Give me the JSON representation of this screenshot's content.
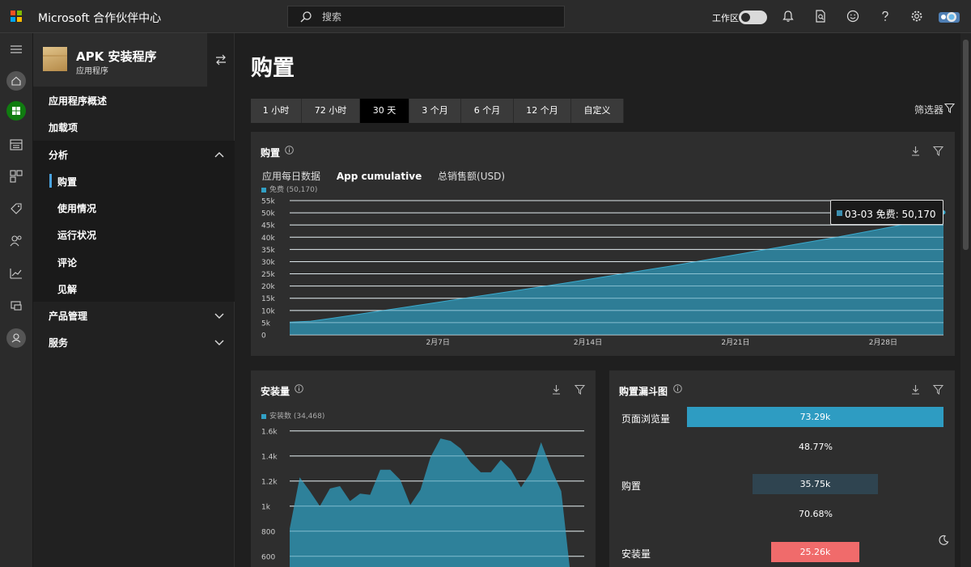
{
  "topbar": {
    "app_name": "Microsoft 合作伙伴中心",
    "search_placeholder": "搜索",
    "workspace_label": "工作区",
    "logo_colors": [
      "#f25022",
      "#7fba00",
      "#00a4ef",
      "#ffb900"
    ]
  },
  "rail": {
    "icons": [
      "menu-icon",
      "home-icon",
      "windows-icon",
      "document-icon",
      "dashboard-icon",
      "tag-icon",
      "users-icon",
      "analytics-icon",
      "devices-icon",
      "profile-icon"
    ]
  },
  "nav": {
    "app_name": "APK 安装程序",
    "app_type": "应用程序",
    "items": [
      {
        "label": "应用程序概述"
      },
      {
        "label": "加载项"
      },
      {
        "label": "分析"
      },
      {
        "label": "购置"
      },
      {
        "label": "使用情况"
      },
      {
        "label": "运行状况"
      },
      {
        "label": "评论"
      },
      {
        "label": "见解"
      },
      {
        "label": "产品管理"
      },
      {
        "label": "服务"
      }
    ]
  },
  "main": {
    "title": "购置",
    "range_tabs": [
      "1 小时",
      "72 小时",
      "30 天",
      "3 个月",
      "6 个月",
      "12 个月",
      "自定义"
    ],
    "active_range": "30 天",
    "filter_label": "筛选器"
  },
  "acquisitions_card": {
    "title": "购置",
    "tabs": [
      "应用每日数据",
      "App cumulative",
      "总销售额(USD)"
    ],
    "active_tab": "App cumulative",
    "legend": "免费 (50,170)",
    "tooltip": "03-03 免费: 50,170"
  },
  "installs_card": {
    "title": "安装量",
    "legend": "安装数 (34,468)"
  },
  "funnel_card": {
    "title": "购置漏斗图",
    "stages": [
      {
        "label": "页面浏览量",
        "value": "73.29k",
        "fraction": 1.0,
        "color": "#2e9cc2"
      },
      {
        "label": "购置",
        "value": "35.75k",
        "fraction": 0.4877,
        "color": "#2f4450"
      },
      {
        "label": "安装量",
        "value": "25.26k",
        "fraction": 0.3447,
        "color": "#f06b6b"
      }
    ],
    "rates": [
      "48.77%",
      "70.68%"
    ]
  },
  "chart_data": [
    {
      "type": "area",
      "title": "购置",
      "series": [
        {
          "name": "免费",
          "x": [
            "01-31",
            "02-01",
            "02-02",
            "02-03",
            "02-04",
            "02-05",
            "02-06",
            "02-07",
            "02-08",
            "02-09",
            "02-10",
            "02-11",
            "02-12",
            "02-13",
            "02-14",
            "02-15",
            "02-16",
            "02-17",
            "02-18",
            "02-19",
            "02-20",
            "02-21",
            "02-22",
            "02-23",
            "02-24",
            "02-25",
            "02-26",
            "02-27",
            "02-28",
            "03-01",
            "03-02",
            "03-03"
          ],
          "values": [
            5200,
            5600,
            6800,
            8100,
            9400,
            10700,
            12000,
            13300,
            14600,
            15900,
            17200,
            18500,
            19800,
            21100,
            22500,
            23900,
            25300,
            26700,
            28100,
            29600,
            31100,
            32600,
            34100,
            35600,
            37100,
            38600,
            40100,
            41700,
            43300,
            45000,
            47500,
            50170
          ]
        }
      ],
      "x_tick_labels": [
        "2月7日",
        "2月14日",
        "2月21日",
        "2月28日"
      ],
      "y_ticks": [
        "0",
        "5k",
        "10k",
        "15k",
        "20k",
        "25k",
        "30k",
        "35k",
        "40k",
        "45k",
        "50k",
        "55k"
      ],
      "ylim": [
        0,
        55000
      ],
      "grid": true
    },
    {
      "type": "area",
      "title": "安装量",
      "series": [
        {
          "name": "安装数",
          "values": [
            820,
            1230,
            1120,
            1000,
            1140,
            1160,
            1040,
            1100,
            1090,
            1290,
            1290,
            1210,
            1010,
            1130,
            1390,
            1540,
            1520,
            1460,
            1350,
            1270,
            1270,
            1370,
            1290,
            1150,
            1270,
            1510,
            1300,
            1120,
            400
          ]
        }
      ],
      "y_ticks": [
        "600",
        "800",
        "1k",
        "1.2k",
        "1.4k",
        "1.6k"
      ],
      "ylim": [
        450,
        1650
      ],
      "grid": true
    }
  ]
}
